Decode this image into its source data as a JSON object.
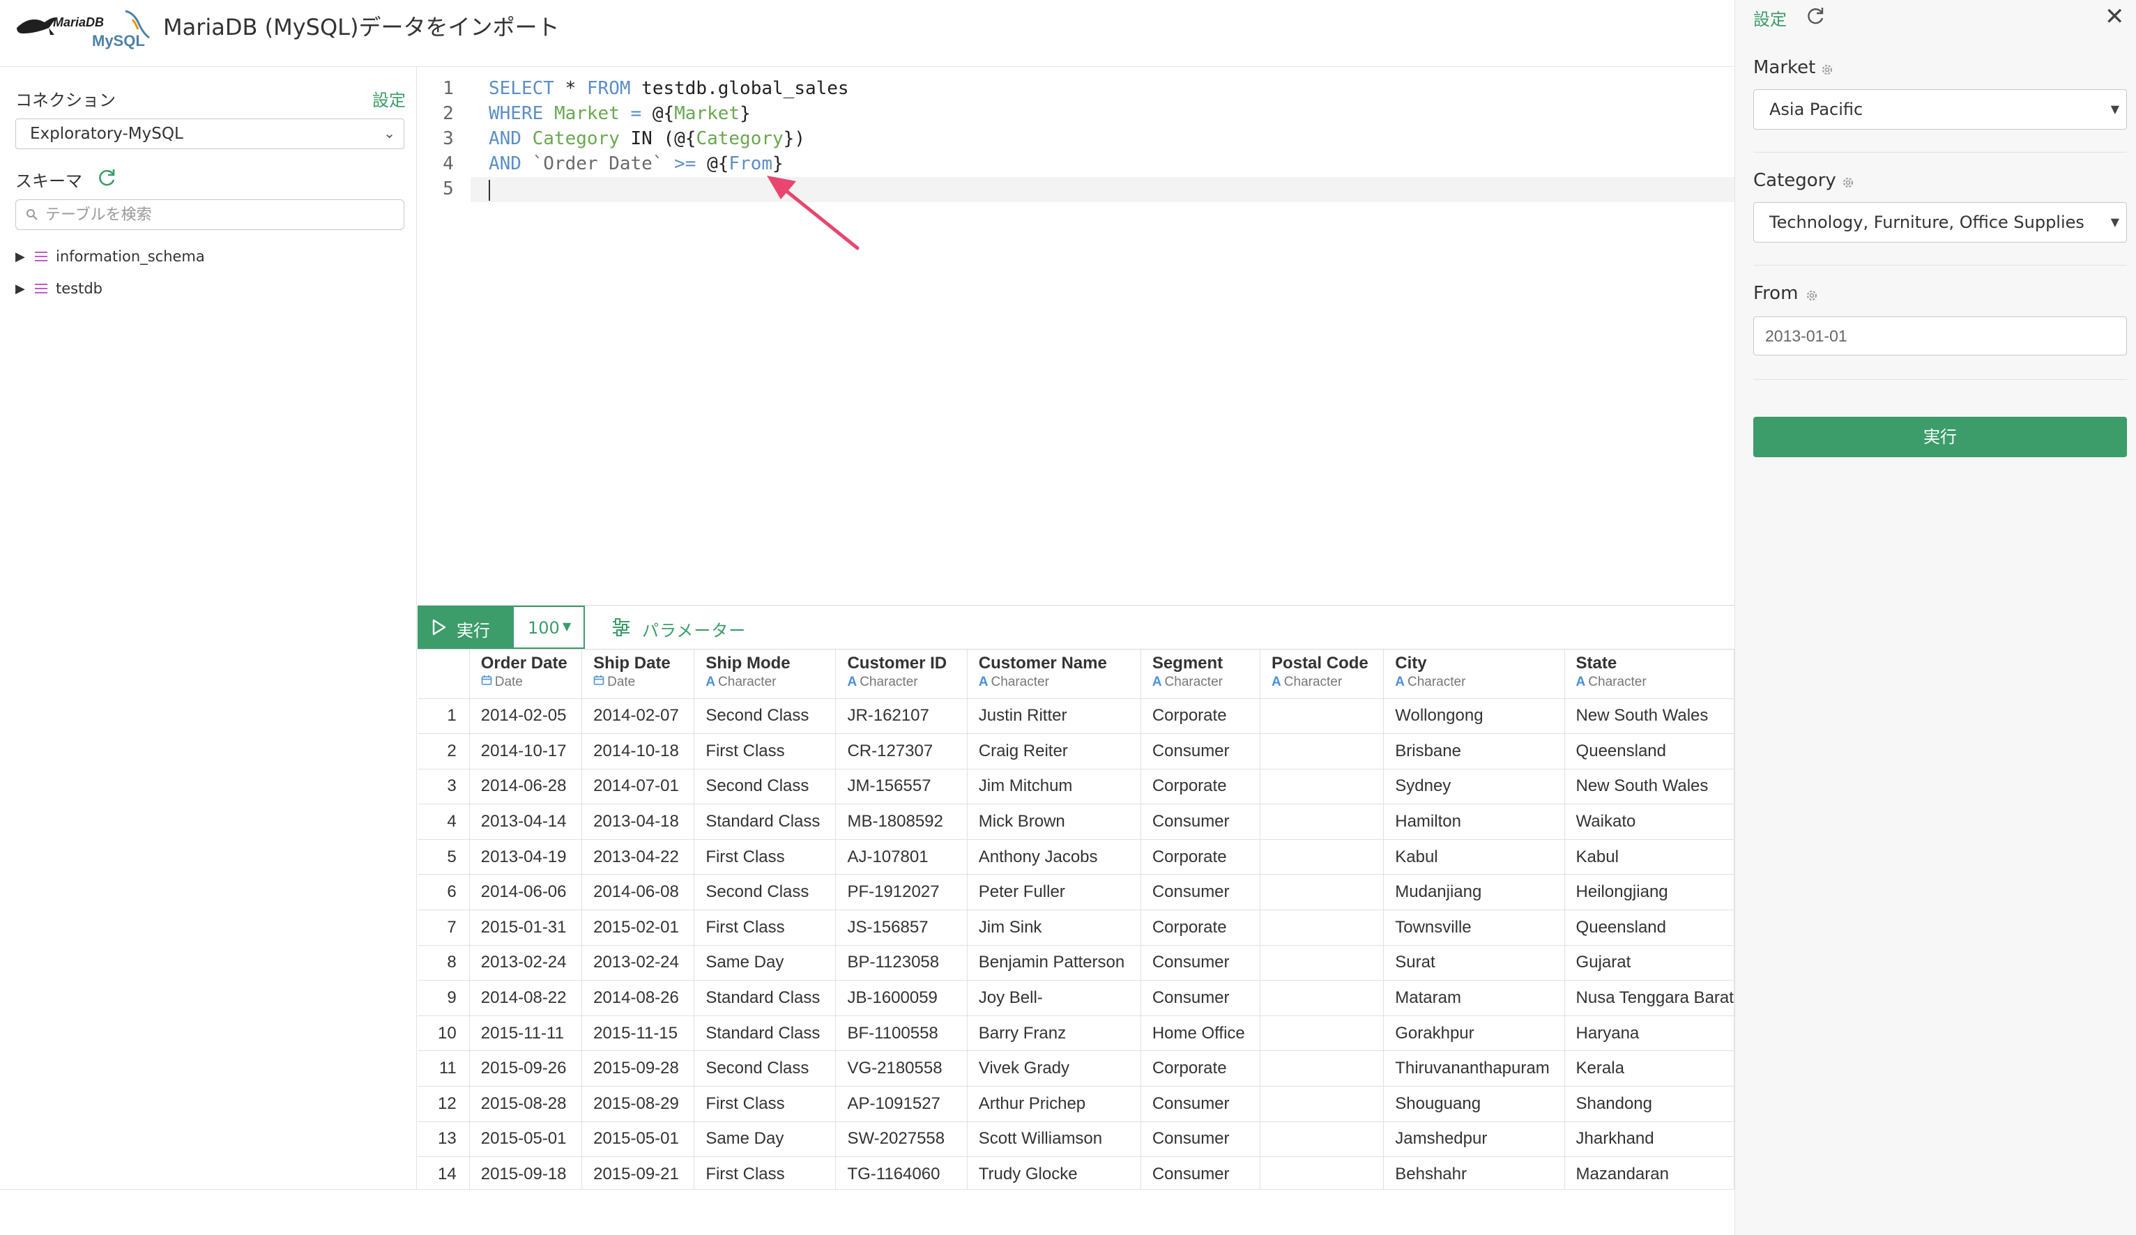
{
  "header": {
    "logo_text_top": "MariaDB",
    "logo_text_bottom": "MySQL",
    "title": "MariaDB (MySQL)データをインポート"
  },
  "sidebar": {
    "connection_label": "コネクション",
    "connection_settings_link": "設定",
    "connection_value": "Exploratory-MySQL",
    "schema_label": "スキーマ",
    "search_placeholder": "テーブルを検索",
    "tree": [
      {
        "label": "information_schema"
      },
      {
        "label": "testdb"
      }
    ]
  },
  "editor": {
    "line_numbers": [
      "1",
      "2",
      "3",
      "4",
      "5"
    ],
    "lines": [
      [
        {
          "t": "SELECT",
          "c": "kw"
        },
        {
          "t": " * ",
          "c": "ident"
        },
        {
          "t": "FROM",
          "c": "kw"
        },
        {
          "t": " testdb.global_sales",
          "c": "ident"
        }
      ],
      [
        {
          "t": "WHERE",
          "c": "kw"
        },
        {
          "t": " ",
          "c": "ident"
        },
        {
          "t": "Market",
          "c": "param"
        },
        {
          "t": " ",
          "c": "ident"
        },
        {
          "t": "=",
          "c": "kw"
        },
        {
          "t": " @{",
          "c": "ident"
        },
        {
          "t": "Market",
          "c": "param"
        },
        {
          "t": "}",
          "c": "ident"
        }
      ],
      [
        {
          "t": "AND",
          "c": "kw"
        },
        {
          "t": " ",
          "c": "ident"
        },
        {
          "t": "Category",
          "c": "param"
        },
        {
          "t": " IN (@{",
          "c": "ident"
        },
        {
          "t": "Category",
          "c": "param"
        },
        {
          "t": "})",
          "c": "ident"
        }
      ],
      [
        {
          "t": "AND",
          "c": "kw"
        },
        {
          "t": " ",
          "c": "ident"
        },
        {
          "t": "`Order Date`",
          "c": "str"
        },
        {
          "t": " ",
          "c": "ident"
        },
        {
          "t": ">=",
          "c": "kw"
        },
        {
          "t": " @{",
          "c": "ident"
        },
        {
          "t": "From",
          "c": "kw"
        },
        {
          "t": "}",
          "c": "ident"
        }
      ],
      []
    ]
  },
  "toolbar": {
    "run_label": "実行",
    "limit_value": "100",
    "params_label": "パラメーター"
  },
  "results": {
    "columns": [
      {
        "name": "Order Date",
        "type": "Date",
        "type_icon": "calendar"
      },
      {
        "name": "Ship Date",
        "type": "Date",
        "type_icon": "calendar"
      },
      {
        "name": "Ship Mode",
        "type": "Character",
        "type_icon": "A"
      },
      {
        "name": "Customer ID",
        "type": "Character",
        "type_icon": "A"
      },
      {
        "name": "Customer Name",
        "type": "Character",
        "type_icon": "A"
      },
      {
        "name": "Segment",
        "type": "Character",
        "type_icon": "A"
      },
      {
        "name": "Postal Code",
        "type": "Character",
        "type_icon": "A"
      },
      {
        "name": "City",
        "type": "Character",
        "type_icon": "A"
      },
      {
        "name": "State",
        "type": "Character",
        "type_icon": "A"
      }
    ],
    "rows": [
      [
        "1",
        "2014-02-05",
        "2014-02-07",
        "Second Class",
        "JR-162107",
        "Justin Ritter",
        "Corporate",
        "",
        "Wollongong",
        "New South Wales"
      ],
      [
        "2",
        "2014-10-17",
        "2014-10-18",
        "First Class",
        "CR-127307",
        "Craig Reiter",
        "Consumer",
        "",
        "Brisbane",
        "Queensland"
      ],
      [
        "3",
        "2014-06-28",
        "2014-07-01",
        "Second Class",
        "JM-156557",
        "Jim Mitchum",
        "Corporate",
        "",
        "Sydney",
        "New South Wales"
      ],
      [
        "4",
        "2013-04-14",
        "2013-04-18",
        "Standard Class",
        "MB-1808592",
        "Mick Brown",
        "Consumer",
        "",
        "Hamilton",
        "Waikato"
      ],
      [
        "5",
        "2013-04-19",
        "2013-04-22",
        "First Class",
        "AJ-107801",
        "Anthony Jacobs",
        "Corporate",
        "",
        "Kabul",
        "Kabul"
      ],
      [
        "6",
        "2014-06-06",
        "2014-06-08",
        "Second Class",
        "PF-1912027",
        "Peter Fuller",
        "Consumer",
        "",
        "Mudanjiang",
        "Heilongjiang"
      ],
      [
        "7",
        "2015-01-31",
        "2015-02-01",
        "First Class",
        "JS-156857",
        "Jim Sink",
        "Corporate",
        "",
        "Townsville",
        "Queensland"
      ],
      [
        "8",
        "2013-02-24",
        "2013-02-24",
        "Same Day",
        "BP-1123058",
        "Benjamin Patterson",
        "Consumer",
        "",
        "Surat",
        "Gujarat"
      ],
      [
        "9",
        "2014-08-22",
        "2014-08-26",
        "Standard Class",
        "JB-1600059",
        "Joy Bell-",
        "Consumer",
        "",
        "Mataram",
        "Nusa Tenggara Barat"
      ],
      [
        "10",
        "2015-11-11",
        "2015-11-15",
        "Standard Class",
        "BF-1100558",
        "Barry Franz",
        "Home Office",
        "",
        "Gorakhpur",
        "Haryana"
      ],
      [
        "11",
        "2015-09-26",
        "2015-09-28",
        "Second Class",
        "VG-2180558",
        "Vivek Grady",
        "Corporate",
        "",
        "Thiruvananthapuram",
        "Kerala"
      ],
      [
        "12",
        "2015-08-28",
        "2015-08-29",
        "First Class",
        "AP-1091527",
        "Arthur Prichep",
        "Consumer",
        "",
        "Shouguang",
        "Shandong"
      ],
      [
        "13",
        "2015-05-01",
        "2015-05-01",
        "Same Day",
        "SW-2027558",
        "Scott Williamson",
        "Consumer",
        "",
        "Jamshedpur",
        "Jharkhand"
      ],
      [
        "14",
        "2015-09-18",
        "2015-09-21",
        "First Class",
        "TG-1164060",
        "Trudy Glocke",
        "Consumer",
        "",
        "Behshahr",
        "Mazandaran"
      ]
    ]
  },
  "params_panel": {
    "settings_link": "設定",
    "market_label": "Market",
    "market_value": "Asia Pacific",
    "category_label": "Category",
    "category_value": "Technology, Furniture, Office Supplies",
    "from_label": "From",
    "from_value": "2013-01-01",
    "run_label": "実行"
  },
  "colors": {
    "accent_green": "#3c9c6a",
    "keyword_blue": "#5b8fc7",
    "param_green": "#6aa84f",
    "annotation_arrow": "#e8466f",
    "type_icon_blue": "#4a90d9"
  }
}
